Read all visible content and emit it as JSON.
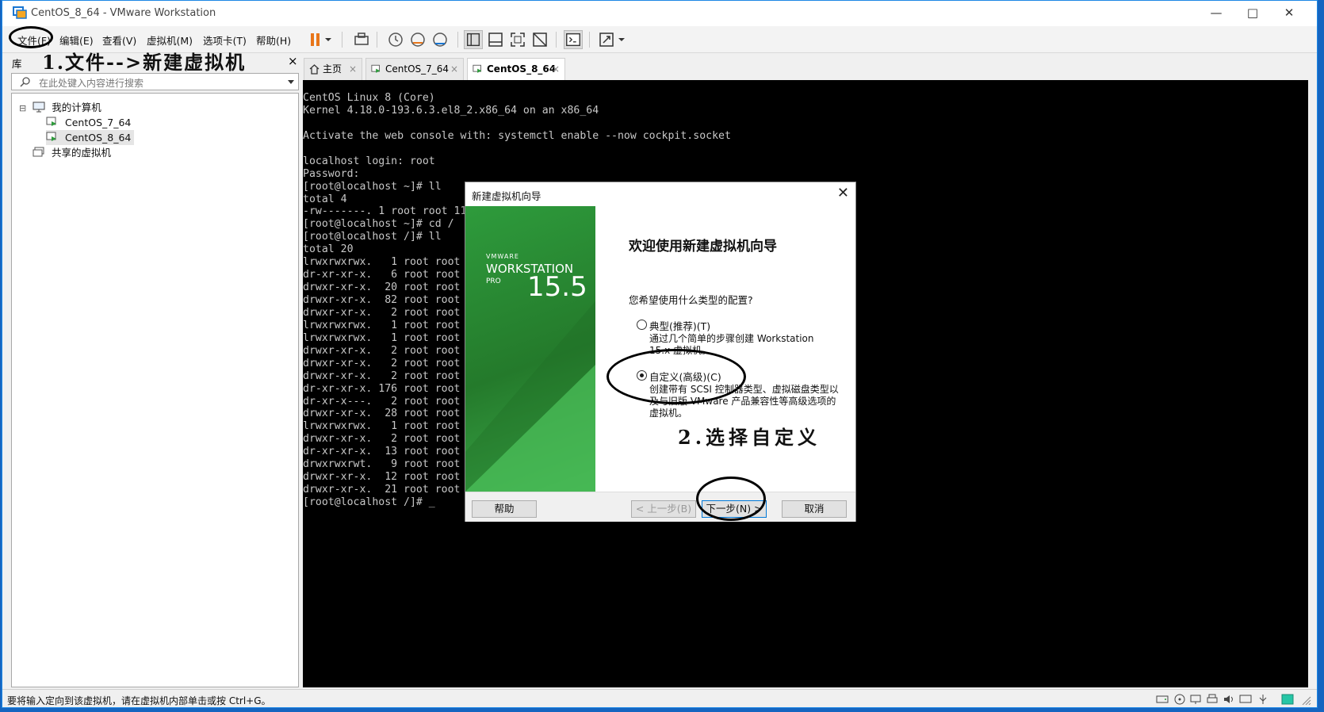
{
  "window": {
    "title": "CentOS_8_64 - VMware Workstation"
  },
  "menubar": {
    "items": [
      "文件(F)",
      "编辑(E)",
      "查看(V)",
      "虚拟机(M)",
      "选项卡(T)",
      "帮助(H)"
    ]
  },
  "annotations": {
    "step1": "1.文件-->新建虚拟机",
    "step2": "2.选择自定义"
  },
  "library": {
    "title": "库",
    "close": "×",
    "search_placeholder": "在此处键入内容进行搜索",
    "tree": {
      "root": "我的计算机",
      "children": [
        "CentOS_7_64",
        "CentOS_8_64"
      ],
      "shared": "共享的虚拟机",
      "expander": "⊟"
    }
  },
  "tabs": [
    {
      "label": "主页"
    },
    {
      "label": "CentOS_7_64"
    },
    {
      "label": "CentOS_8_64"
    }
  ],
  "console": {
    "lines": [
      "CentOS Linux 8 (Core)",
      "Kernel 4.18.0-193.6.3.el8_2.x86_64 on an x86_64",
      "",
      "Activate the web console with: systemctl enable --now cockpit.socket",
      "",
      "localhost login: root",
      "Password:",
      "[root@localhost ~]# ll",
      "total 4",
      "-rw-------. 1 root root 11",
      "[root@localhost ~]# cd /",
      "[root@localhost /]# ll",
      "total 20",
      "lrwxrwxrwx.   1 root root",
      "dr-xr-xr-x.   6 root root",
      "drwxr-xr-x.  20 root root",
      "drwxr-xr-x.  82 root root",
      "drwxr-xr-x.   2 root root",
      "lrwxrwxrwx.   1 root root",
      "lrwxrwxrwx.   1 root root",
      "drwxr-xr-x.   2 root root",
      "drwxr-xr-x.   2 root root",
      "drwxr-xr-x.   2 root root",
      "dr-xr-xr-x. 176 root root",
      "dr-xr-x---.   2 root root",
      "drwxr-xr-x.  28 root root",
      "lrwxrwxrwx.   1 root root",
      "drwxr-xr-x.   2 root root",
      "dr-xr-xr-x.  13 root root",
      "drwxrwxrwt.   9 root root",
      "drwxr-xr-x.  12 root root",
      "drwxr-xr-x.  21 root root",
      "[root@localhost /]# _"
    ]
  },
  "dialog": {
    "title": "新建虚拟机向导",
    "close": "✕",
    "banner": {
      "brand": "VMWARE",
      "product": "WORKSTATION",
      "edition": "PRO",
      "version": "15.5"
    },
    "heading": "欢迎使用新建虚拟机向导",
    "question": "您希望使用什么类型的配置?",
    "options": [
      {
        "label": "典型(推荐)(T)",
        "desc": "通过几个简单的步骤创建 Workstation 15.x 虚拟机。",
        "checked": false
      },
      {
        "label": "自定义(高级)(C)",
        "desc": "创建带有 SCSI 控制器类型、虚拟磁盘类型以及与旧版 VMware 产品兼容性等高级选项的虚拟机。",
        "checked": true
      }
    ],
    "buttons": {
      "help": "帮助",
      "back": "< 上一步(B)",
      "next": "下一步(N) >",
      "cancel": "取消"
    }
  },
  "statusbar": {
    "text": "要将输入定向到该虚拟机，请在虚拟机内部单击或按 Ctrl+G。"
  },
  "colors": {
    "accent": "#0078d7",
    "banner_green": "#2e9b3c",
    "pause_orange": "#e8761a"
  }
}
